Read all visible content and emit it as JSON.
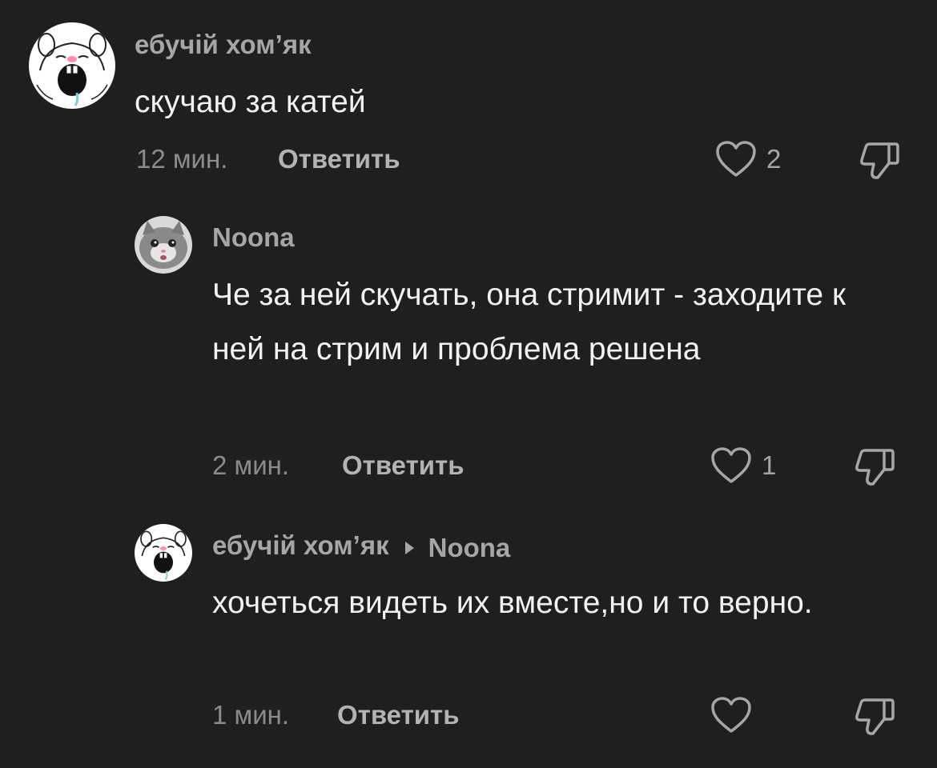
{
  "comments": [
    {
      "username": "ебучій хом’як",
      "text": "скучаю за катей",
      "time": "12 мин.",
      "reply_label": "Ответить",
      "likes": "2",
      "avatar_icon": "hamster-screaming-avatar"
    },
    {
      "username": "Noona",
      "text": "Че за ней скучать, она стримит - заходите к ней на стрим и проблема решена",
      "time": "2 мин.",
      "reply_label": "Ответить",
      "likes": "1",
      "avatar_icon": "kitten-avatar"
    },
    {
      "username": "ебучій хом’як",
      "reply_to": "Noona",
      "text": "хочеться видеть их вместе,но и то верно.",
      "time": "1 мин.",
      "reply_label": "Ответить",
      "likes": "",
      "avatar_icon": "hamster-screaming-avatar"
    }
  ],
  "colors": {
    "background": "#1f1f1f",
    "text": "#f2f2f2",
    "muted": "#a6a6a6"
  }
}
